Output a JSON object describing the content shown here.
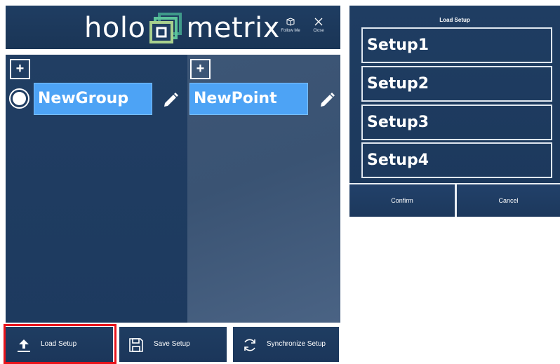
{
  "app": {
    "logo_left": "holo",
    "logo_right": "metrix",
    "follow_me_label": "Follow Me",
    "close_label": "Close"
  },
  "groups": {
    "add_label": "+",
    "items": [
      {
        "label": "NewGroup",
        "selected": true
      }
    ]
  },
  "points": {
    "add_label": "+",
    "items": [
      {
        "label": "NewPoint"
      }
    ]
  },
  "toolbar": {
    "load_label": "Load Setup",
    "save_label": "Save Setup",
    "sync_label": "Synchronize Setup"
  },
  "dialog": {
    "title": "Load Setup",
    "setups": [
      "Setup1",
      "Setup2",
      "Setup3",
      "Setup4"
    ],
    "confirm_label": "Confirm",
    "cancel_label": "Cancel"
  },
  "colors": {
    "panel_bg": "#1f3d62",
    "item_highlight": "#4da3f5",
    "annotation_border": "#e8141c"
  }
}
